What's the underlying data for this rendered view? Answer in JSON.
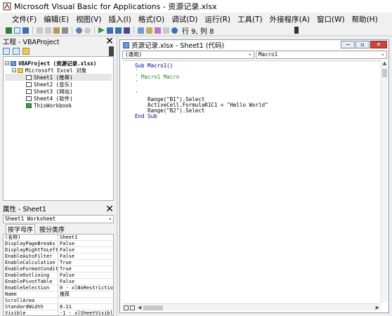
{
  "window": {
    "title": "Microsoft Visual Basic for Applications - 资源记录.xlsx"
  },
  "menu": [
    "文件(F)",
    "编辑(E)",
    "视图(V)",
    "插入(I)",
    "格式(O)",
    "调试(D)",
    "运行(R)",
    "工具(T)",
    "外接程序(A)",
    "窗口(W)",
    "帮助(H)"
  ],
  "toolbar": {
    "position": "行 9, 列 8"
  },
  "project": {
    "header": "工程 - VBAProject",
    "tree": {
      "root": "VBAProject (资源记录.xlsx)",
      "folder": "Microsoft Excel 对象",
      "items": [
        "Sheet1 (推荐)",
        "Sheet2 (音乐)",
        "Sheet3 (网站)",
        "Sheet4 (软件)",
        "ThisWorkbook"
      ]
    }
  },
  "properties": {
    "header": "属性 - Sheet1",
    "object": "Sheet1 Worksheet",
    "tabs": [
      "按字母序",
      "按分类序"
    ],
    "rows": [
      [
        "(名称)",
        "Sheet1"
      ],
      [
        "DisplayPageBreaks",
        "False"
      ],
      [
        "DisplayRightToLeft",
        "False"
      ],
      [
        "EnableAutoFilter",
        "False"
      ],
      [
        "EnableCalculation",
        "True"
      ],
      [
        "EnableFormatConditi",
        "True"
      ],
      [
        "EnableOutlining",
        "False"
      ],
      [
        "EnablePivotTable",
        "False"
      ],
      [
        "EnableSelection",
        "0 - xlNoRestrictio"
      ],
      [
        "Name",
        "推荐"
      ],
      [
        "ScrollArea",
        ""
      ],
      [
        "StandardWidth",
        "8.11"
      ],
      [
        "Visible",
        "-1 - xlSheetVisibl"
      ]
    ]
  },
  "code": {
    "title": "资源记录.xlsx - Sheet1 (代码)",
    "object_combo": "(通用)",
    "proc_combo": "Macro1",
    "lines": [
      "Sub Macro1()",
      "'",
      "' Macro1 Macro",
      "'",
      "",
      "'",
      "    Range(\"B1\").Select",
      "    ActiveCell.FormulaR1C1 = \"Hello World\"",
      "    Range(\"B2\").Select",
      "End Sub"
    ]
  }
}
